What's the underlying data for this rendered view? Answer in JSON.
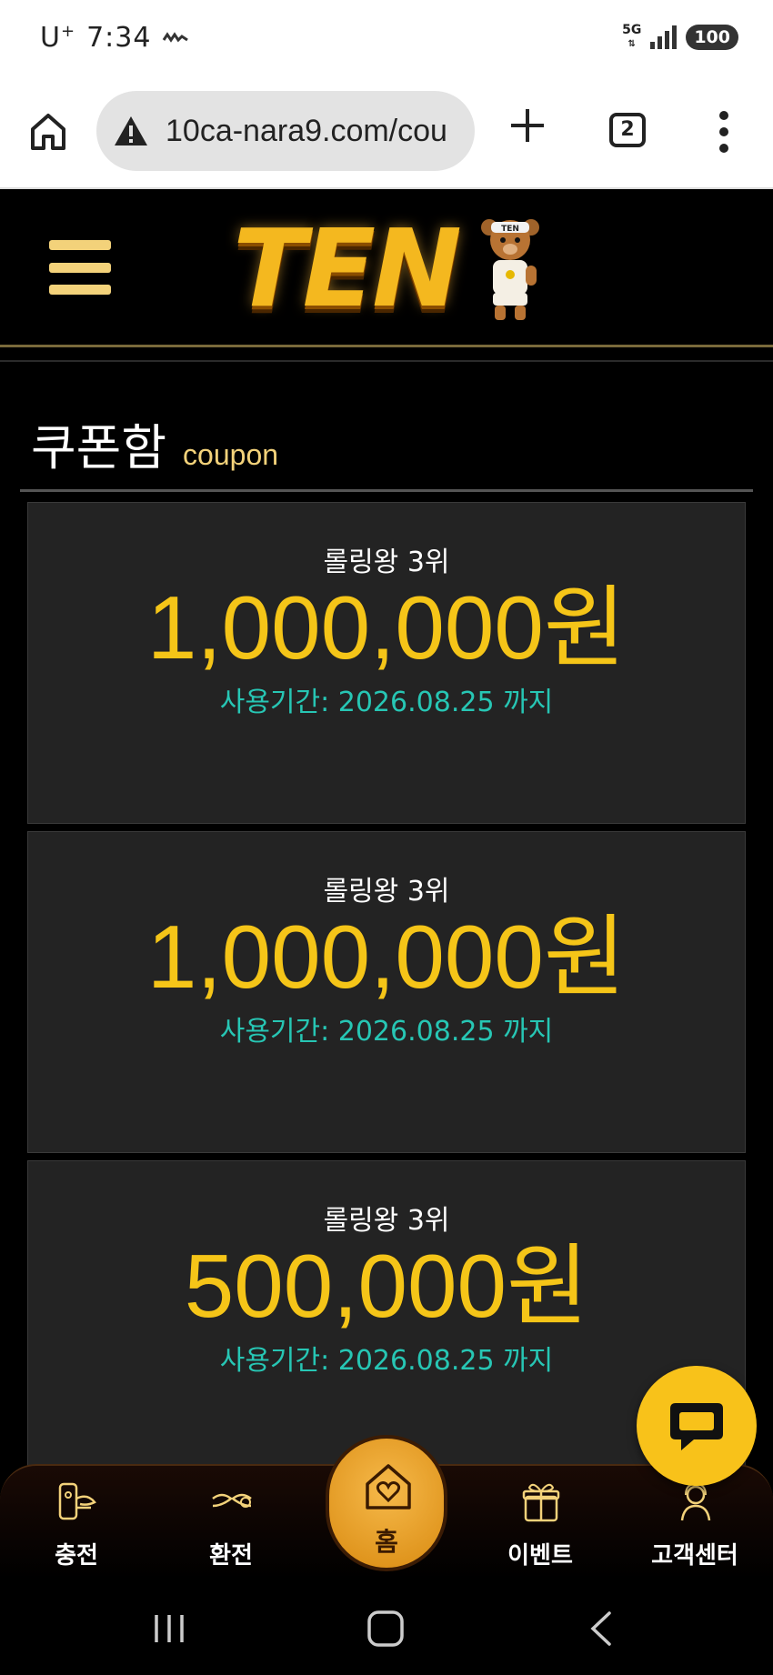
{
  "status_bar": {
    "carrier": "U",
    "carrier_sup": "+",
    "time": "7:34",
    "network": "5G",
    "battery": "100"
  },
  "browser": {
    "url": "10ca-nara9.com/cou",
    "tab_count": "2"
  },
  "site": {
    "logo_text": "TEN",
    "bear_cap_text": "TEN"
  },
  "page": {
    "title": "쿠폰함",
    "subtitle": "coupon"
  },
  "coupons": [
    {
      "name": "롤링왕 3위",
      "amount": "1,000,000원",
      "expires": "사용기간: 2026.08.25 까지"
    },
    {
      "name": "롤링왕 3위",
      "amount": "1,000,000원",
      "expires": "사용기간: 2026.08.25 까지"
    },
    {
      "name": "롤링왕 3위",
      "amount": "500,000원",
      "expires": "사용기간: 2026.08.25 까지"
    }
  ],
  "bottom_nav": {
    "items": [
      {
        "label": "충전",
        "icon": "deposit-icon"
      },
      {
        "label": "환전",
        "icon": "withdraw-icon"
      },
      {
        "label": "홈",
        "icon": "home-heart-icon"
      },
      {
        "label": "이벤트",
        "icon": "gift-icon"
      },
      {
        "label": "고객센터",
        "icon": "support-agent-icon"
      }
    ]
  },
  "colors": {
    "accent_gold": "#f5c518",
    "expire_teal": "#27c6b4",
    "card_bg": "#232323",
    "fab_yellow": "#f8c21a"
  }
}
